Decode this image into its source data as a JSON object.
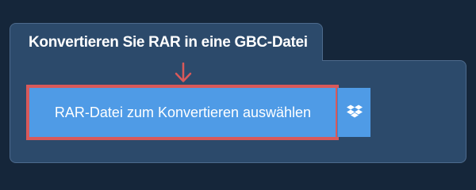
{
  "tab": {
    "title": "Konvertieren Sie RAR in eine GBC-Datei"
  },
  "upload": {
    "button_label": "RAR-Datei zum Konvertieren auswählen",
    "dropbox_icon": "dropbox-icon",
    "arrow_icon": "arrow-down-icon"
  },
  "colors": {
    "background": "#15263a",
    "panel": "#2c4a6b",
    "button": "#4f9be6",
    "highlight": "#d9595a",
    "text": "#ffffff"
  }
}
